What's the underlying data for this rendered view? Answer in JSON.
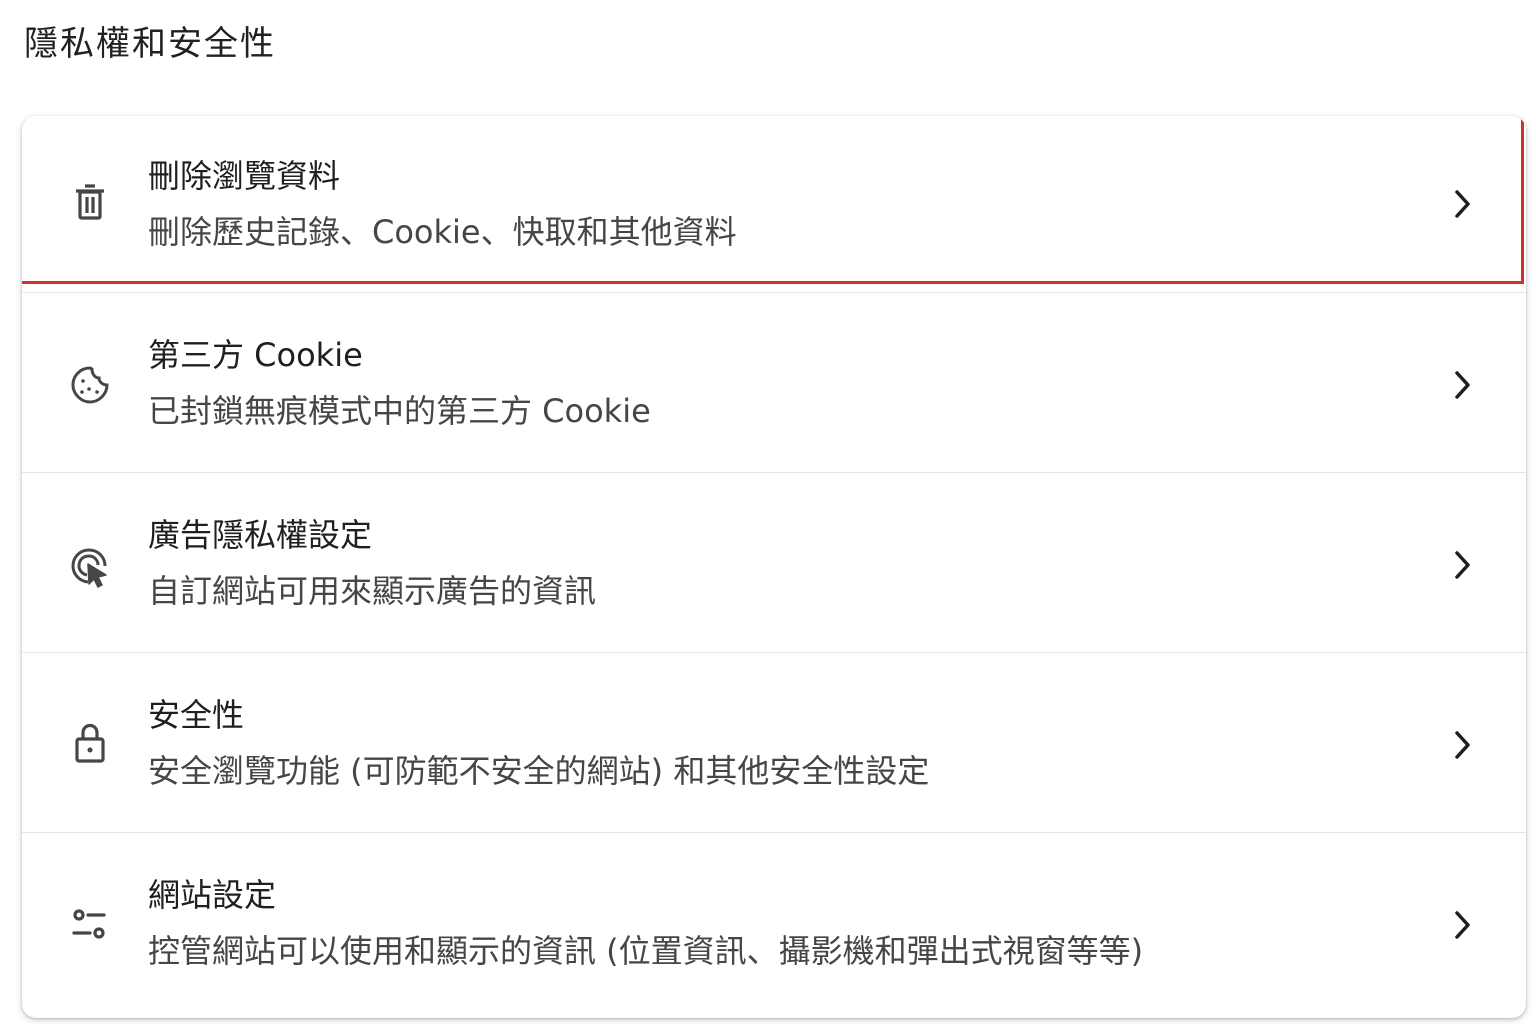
{
  "page": {
    "title": "隱私權和安全性"
  },
  "colors": {
    "highlight_border": "#d32f2f",
    "title_text": "#1f1f1f",
    "subtitle_text": "#444746",
    "icon": "#444746"
  },
  "items": [
    {
      "title": "刪除瀏覽資料",
      "subtitle": "刪除歷史記錄、Cookie、快取和其他資料",
      "icon": "trash-icon",
      "highlighted": true
    },
    {
      "title": "第三方 Cookie",
      "subtitle": "已封鎖無痕模式中的第三方 Cookie",
      "icon": "cookie-icon",
      "highlighted": false
    },
    {
      "title": "廣告隱私權設定",
      "subtitle": "自訂網站可用來顯示廣告的資訊",
      "icon": "ad-privacy-icon",
      "highlighted": false
    },
    {
      "title": "安全性",
      "subtitle": "安全瀏覽功能 (可防範不安全的網站) 和其他安全性設定",
      "icon": "lock-icon",
      "highlighted": false
    },
    {
      "title": "網站設定",
      "subtitle": "控管網站可以使用和顯示的資訊 (位置資訊、攝影機和彈出式視窗等等)",
      "icon": "tune-icon",
      "highlighted": false
    }
  ]
}
